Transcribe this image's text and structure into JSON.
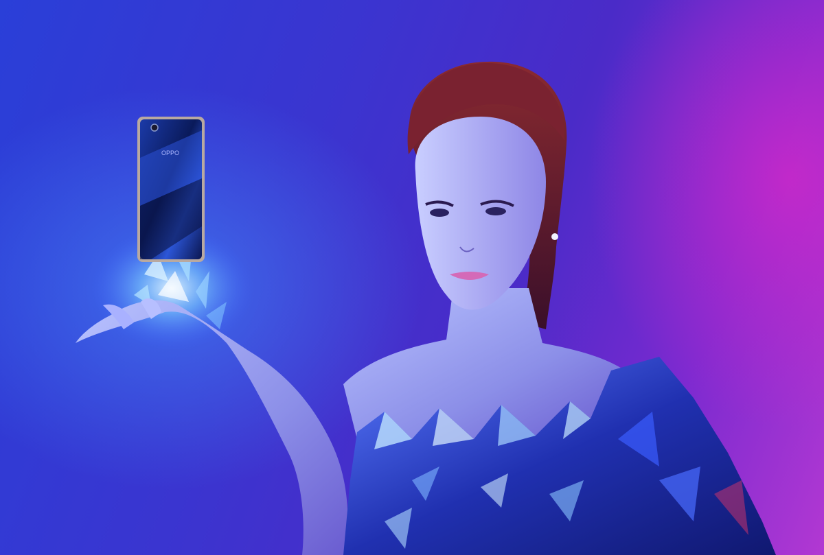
{
  "scene": {
    "description_tags": [
      "woman-in-crystal-dress",
      "floating-smartphone",
      "blue-purple-studio-backdrop"
    ],
    "colors": {
      "backdrop_blue": "#2a3fd8",
      "backdrop_purple": "#b238d2",
      "phone_body": "#0c1e66",
      "hair": "#5a1a2a",
      "crystal_glow": "#8fd6ff"
    },
    "phone": {
      "brand_text": "OPPO"
    }
  }
}
